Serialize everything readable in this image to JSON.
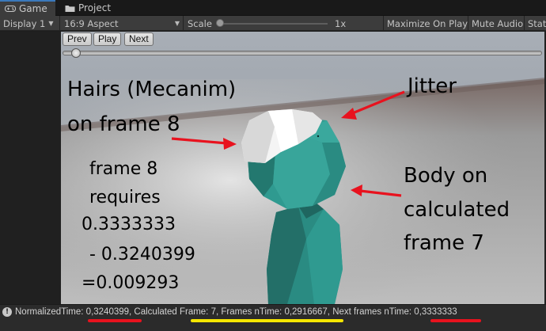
{
  "tabs": [
    {
      "label": "Game",
      "icon": "gamepad-icon"
    },
    {
      "label": "Project",
      "icon": "folder-icon"
    }
  ],
  "toolbar": {
    "display": "Display 1",
    "aspect": "16:9 Aspect",
    "scale_label": "Scale",
    "scale_value": "1x",
    "maximize": "Maximize On Play",
    "mute": "Mute Audio",
    "stats": "Stats"
  },
  "controls": {
    "prev": "Prev",
    "play": "Play",
    "next": "Next",
    "slider_fraction": 0.03
  },
  "annotations": {
    "hairs_line1": "Hairs (Mecanim)",
    "hairs_line2": "on frame 8",
    "jitter": "Jitter",
    "body_line1": "Body on",
    "body_line2": "calculated",
    "body_line3": "frame 7",
    "calc_line1": "frame 8",
    "calc_line2": "requires",
    "calc_line3": "0.3333333",
    "calc_line4": "- 0.3240399",
    "calc_line5": "=0.009293"
  },
  "status": {
    "text": "NormalizedTime: 0,3240399, Calculated Frame: 7, Frames nTime: 0,2916667, Next frames nTime: 0,3333333"
  },
  "colors": {
    "arrow": "#e8121e",
    "underline_red": "#e8121e",
    "underline_yellow": "#f5e600",
    "character": "#2a8b82",
    "hair": "#f2f2f2"
  }
}
